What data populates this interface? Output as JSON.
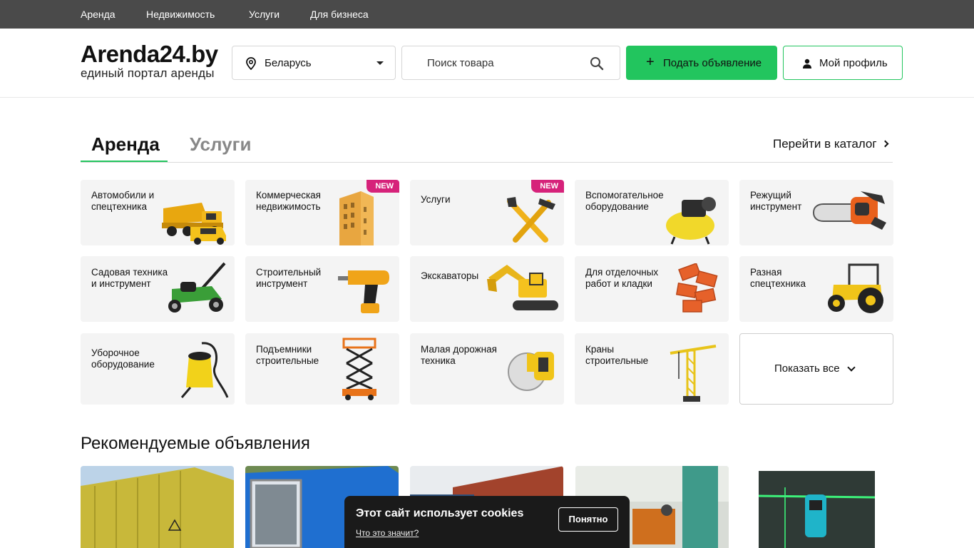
{
  "topnav": [
    "Аренда",
    "Недвижимость",
    "Услуги",
    "Для бизнеса"
  ],
  "logo": {
    "title": "Arenda24.by",
    "subtitle": "единый портал аренды"
  },
  "region": {
    "value": "Беларусь"
  },
  "search": {
    "placeholder": "Поиск товара"
  },
  "actions": {
    "post_label": "Подать объявление",
    "profile_label": "Мой профиль"
  },
  "tabs": {
    "active": "Аренда",
    "inactive": "Услуги",
    "catalog_link": "Перейти в каталог"
  },
  "categories": [
    {
      "label": "Автомобили и спецтехника",
      "icon": "truck-icon"
    },
    {
      "label": "Коммерческая недвижимость",
      "icon": "building-icon",
      "badge": "NEW"
    },
    {
      "label": "Услуги",
      "icon": "tools-icon",
      "badge": "NEW"
    },
    {
      "label": "Вспомогательное оборудование",
      "icon": "compressor-icon"
    },
    {
      "label": "Режущий инструмент",
      "icon": "chainsaw-icon"
    },
    {
      "label": "Садовая техника и инструмент",
      "icon": "lawnmower-icon"
    },
    {
      "label": "Строительный инструмент",
      "icon": "drill-icon"
    },
    {
      "label": "Экскаваторы",
      "icon": "excavator-icon"
    },
    {
      "label": "Для отделочных работ и кладки",
      "icon": "bricks-icon"
    },
    {
      "label": "Разная спецтехника",
      "icon": "tractor-icon"
    },
    {
      "label": "Уборочное оборудование",
      "icon": "vacuum-icon"
    },
    {
      "label": "Подъемники строительные",
      "icon": "scissor-lift-icon"
    },
    {
      "label": "Малая дорожная техника",
      "icon": "road-saw-icon"
    },
    {
      "label": "Краны строительные",
      "icon": "crane-icon"
    }
  ],
  "show_all": "Показать все",
  "recommended": {
    "title": "Рекомендуемые объявления"
  },
  "cookie": {
    "title": "Этот сайт использует cookies",
    "link": "Что это значит?",
    "button": "Понятно"
  },
  "colors": {
    "accent": "#22c55e",
    "topbar": "#4a4a4a",
    "badge": "#d6227a"
  }
}
